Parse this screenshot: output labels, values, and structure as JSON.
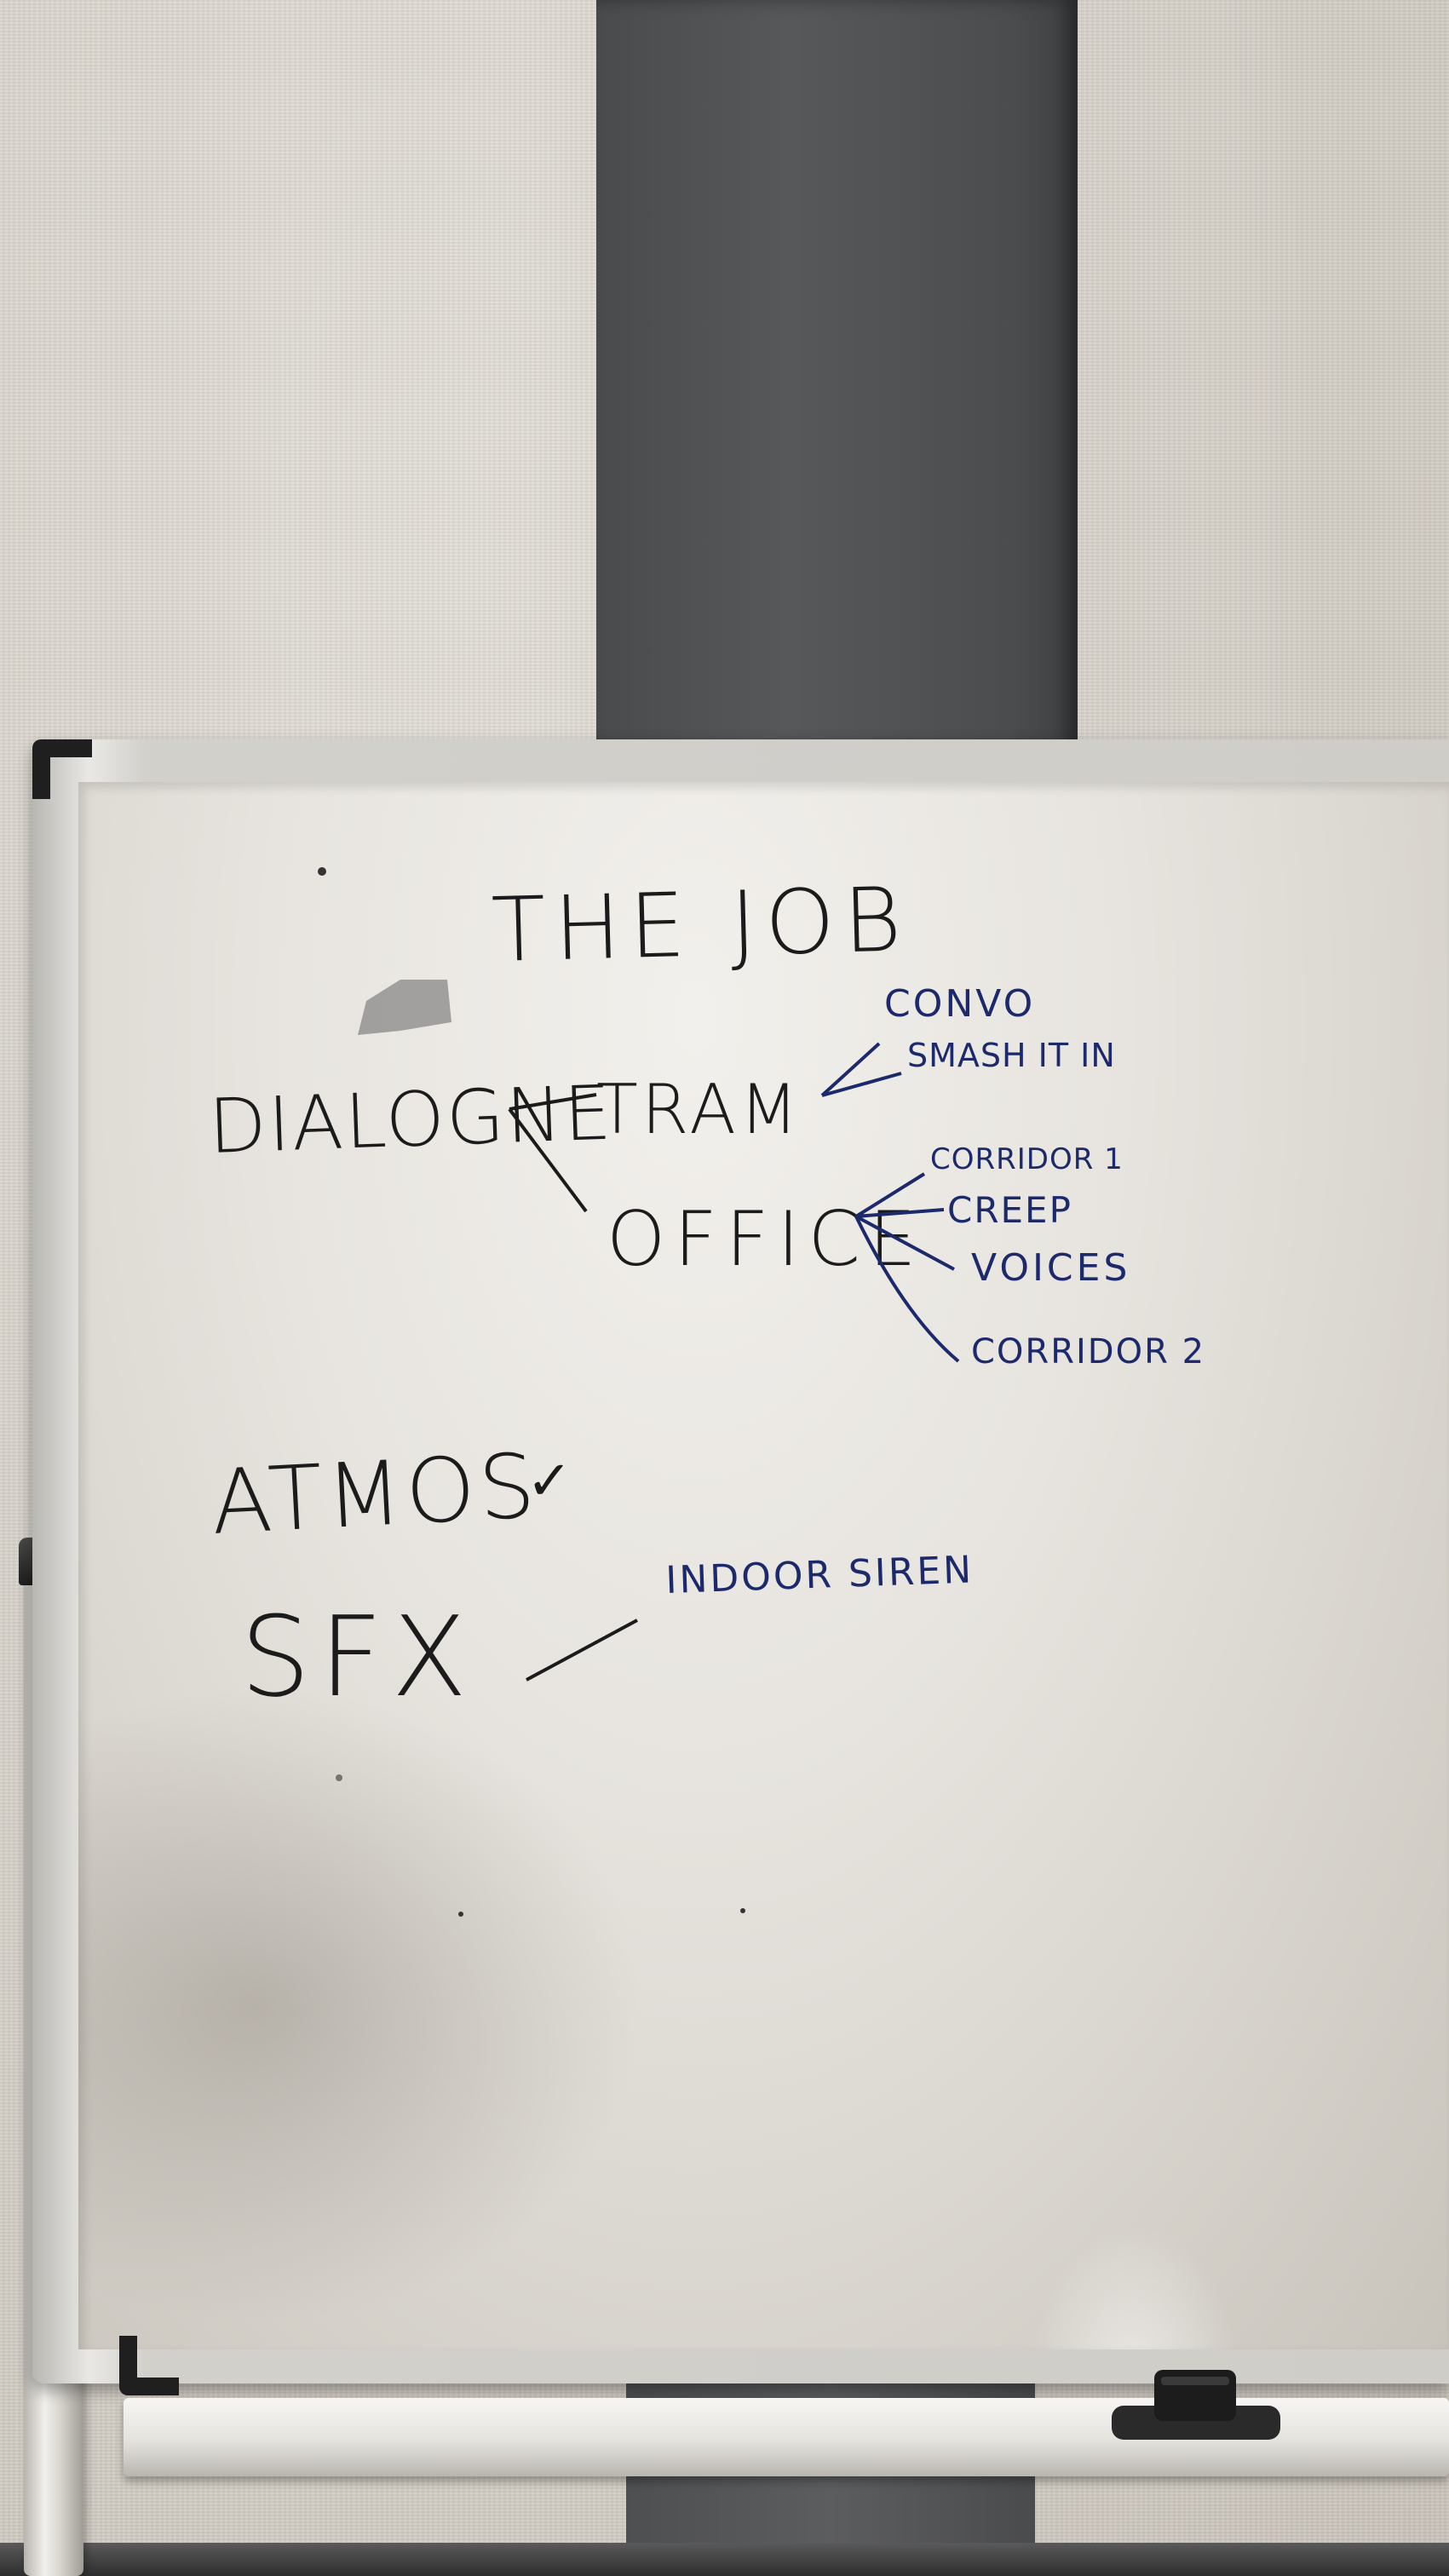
{
  "whiteboard": {
    "title": "THE JOB",
    "dialogue": {
      "label": "DIALOGNE",
      "tram": {
        "label": "TRAM",
        "items": [
          "CONVO",
          "SMASH IT IN"
        ]
      },
      "office": {
        "label": "OFFICE",
        "items": [
          "CORRIDOR 1",
          "CREEP",
          "VOICES",
          "CORRIDOR 2"
        ]
      }
    },
    "atmos": {
      "label": "ATMOS",
      "check": "✓"
    },
    "sfx": {
      "label": "SFX",
      "items": [
        "INDOOR SIREN"
      ]
    }
  },
  "colors": {
    "black_marker": "#1b1b1b",
    "blue_marker": "#1c2a6b",
    "board": "#e9e6e1",
    "wall": "#d6d1c9",
    "dark_panel": "#505153"
  }
}
